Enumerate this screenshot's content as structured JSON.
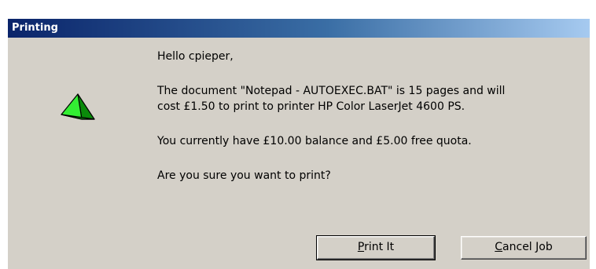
{
  "window": {
    "title": "Printing"
  },
  "icon": {
    "name": "green-pyramid-icon",
    "colors": {
      "light": "#33ee33",
      "dark": "#0a8a0a",
      "outline": "#000000"
    }
  },
  "message": {
    "greeting": "Hello cpieper,",
    "document_line1": "The document \"Notepad - AUTOEXEC.BAT\" is 15 pages and will",
    "document_line2": "cost £1.50 to print to printer HP Color LaserJet 4600 PS.",
    "balance": "You currently have £10.00 balance and £5.00 free quota.",
    "question": "Are you sure you want to print?"
  },
  "buttons": {
    "print": {
      "mnemonic": "P",
      "rest": "rint It"
    },
    "cancel": {
      "mnemonic": "C",
      "rest": "ancel Job"
    }
  },
  "colors": {
    "dialog_bg": "#d4d0c8",
    "title_start": "#0a246a",
    "title_end": "#a6caf0"
  }
}
